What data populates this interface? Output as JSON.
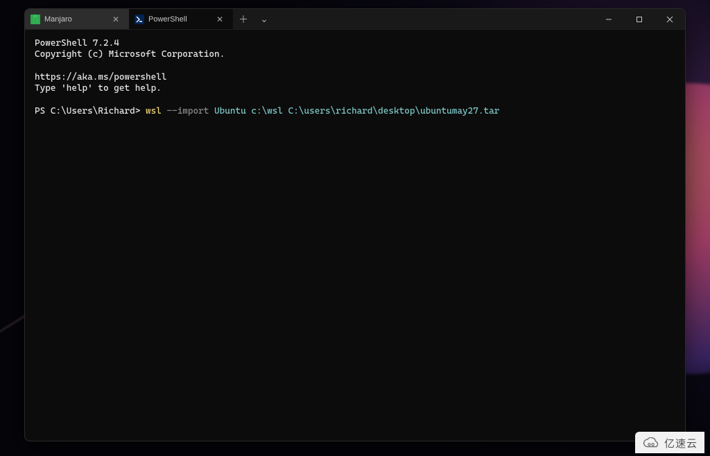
{
  "tabs": [
    {
      "label": "Manjaro",
      "active": false,
      "icon": "manjaro"
    },
    {
      "label": "PowerShell",
      "active": true,
      "icon": "powershell"
    }
  ],
  "lines": {
    "l1": "PowerShell 7.2.4",
    "l2": "Copyright (c) Microsoft Corporation.",
    "l3": "",
    "l4": "https://aka.ms/powershell",
    "l5": "Type 'help' to get help.",
    "l6": ""
  },
  "prompt": {
    "prefix": "PS C:\\Users\\Richard> ",
    "cmd": "wsl",
    "flag": "--import",
    "args": "Ubuntu c:\\wsl C:\\users\\richard\\desktop\\ubuntumay27.tar"
  },
  "watermark": {
    "text": "亿速云"
  }
}
